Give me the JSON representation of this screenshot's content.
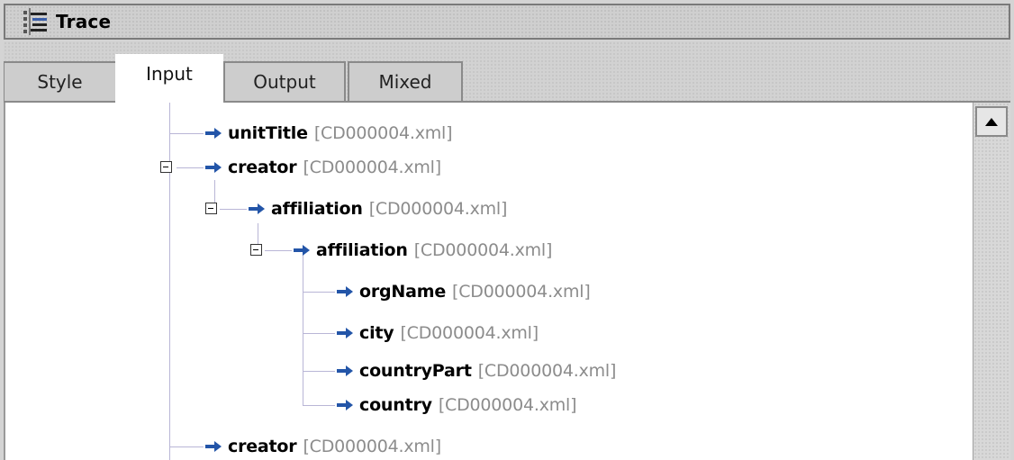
{
  "window": {
    "title": "Trace",
    "icon": "trace-icon"
  },
  "tabs": [
    {
      "label": "Style",
      "active": false
    },
    {
      "label": "Input",
      "active": true
    },
    {
      "label": "Output",
      "active": false
    },
    {
      "label": "Mixed",
      "active": false
    }
  ],
  "tree": {
    "nodes": [
      {
        "name": "unitTitle",
        "file": "[CD000004.xml]",
        "depth": 0,
        "expanded": null,
        "icon": "arrow-right-icon"
      },
      {
        "name": "creator",
        "file": "[CD000004.xml]",
        "depth": 0,
        "expanded": true,
        "icon": "arrow-right-icon"
      },
      {
        "name": "affiliation",
        "file": "[CD000004.xml]",
        "depth": 1,
        "expanded": true,
        "icon": "arrow-right-icon"
      },
      {
        "name": "affiliation",
        "file": "[CD000004.xml]",
        "depth": 2,
        "expanded": true,
        "icon": "arrow-right-icon"
      },
      {
        "name": "orgName",
        "file": "[CD000004.xml]",
        "depth": 3,
        "expanded": null,
        "icon": "arrow-right-icon"
      },
      {
        "name": "city",
        "file": "[CD000004.xml]",
        "depth": 3,
        "expanded": null,
        "icon": "arrow-right-icon"
      },
      {
        "name": "countryPart",
        "file": "[CD000004.xml]",
        "depth": 3,
        "expanded": null,
        "icon": "arrow-right-icon"
      },
      {
        "name": "country",
        "file": "[CD000004.xml]",
        "depth": 3,
        "expanded": null,
        "icon": "arrow-right-icon"
      },
      {
        "name": "creator",
        "file": "[CD000004.xml]",
        "depth": 0,
        "expanded": null,
        "icon": "arrow-right-icon"
      }
    ]
  },
  "colors": {
    "arrow": "#2355a8",
    "tree_line": "#b9b6d6",
    "file_text": "#8c8c8c"
  }
}
